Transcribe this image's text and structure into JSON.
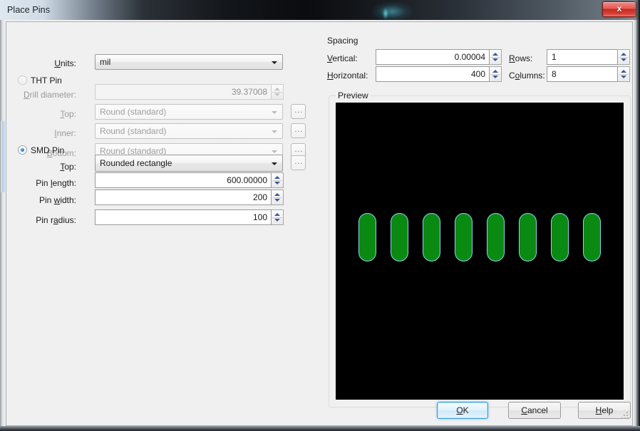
{
  "window": {
    "title": "Place Pins",
    "close_label": "x"
  },
  "left_panel": {
    "units_label": "Units:",
    "units_value": "mil",
    "tht_radio_label": "THT Pin",
    "tht_selected": false,
    "drill_diameter_label": "Drill diameter:",
    "drill_diameter_value": "39.37008",
    "tht_top_label": "Top:",
    "tht_top_value": "Round (standard)",
    "tht_inner_label": "Inner:",
    "tht_inner_value": "Round (standard)",
    "tht_bottom_label": "Bottom:",
    "tht_bottom_value": "Round (standard)",
    "smd_radio_label": "SMD Pin",
    "smd_selected": true,
    "smd_top_label": "Top:",
    "smd_top_value": "Rounded rectangle",
    "pin_length_label": "Pin length:",
    "pin_length_value": "600.00000",
    "pin_width_label": "Pin width:",
    "pin_width_value": "200",
    "pin_radius_label": "Pin radius:",
    "pin_radius_value": "100",
    "ellipsis_label": "..."
  },
  "spacing": {
    "group_label": "Spacing",
    "vertical_label": "Vertical:",
    "vertical_value": "0.00004",
    "horizontal_label": "Horizontal:",
    "horizontal_value": "400",
    "rows_label": "Rows:",
    "rows_value": "1",
    "columns_label": "Columns:",
    "columns_value": "8"
  },
  "preview": {
    "group_label": "Preview",
    "background_color": "#000000",
    "pin_fill_color": "#0a8a12",
    "pin_border_color": "#86d8ee",
    "pin_count": 8,
    "pin_rows": 1
  },
  "footer": {
    "ok_label": "OK",
    "cancel_label": "Cancel",
    "help_label": "Help"
  }
}
